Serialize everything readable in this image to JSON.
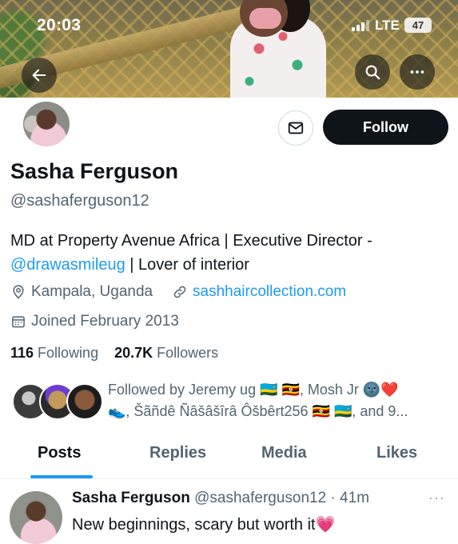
{
  "status_bar": {
    "time": "20:03",
    "network": "LTE",
    "battery": "47"
  },
  "profile": {
    "name": "Sasha Ferguson",
    "handle": "@sashaferguson12",
    "follow_label": "Follow",
    "bio_part1": "MD at Property Avenue Africa | Executive Director -",
    "bio_link": "@drawasmileug",
    "bio_part2": " | Lover of interior",
    "location": "Kampala, Uganda",
    "website": "sashhaircollection.com",
    "joined": "Joined February 2013",
    "following_count": "116",
    "following_label": " Following",
    "followers_count": "20.7K",
    "followers_label": " Followers",
    "followed_by_line1": "Followed by Jeremy ug 🇷🇼 🇺🇬, Mosh Jr 🌚❤️",
    "followed_by_line2": "👟, Šãñdê Ñâšâšîrâ Ôšbêrt256 🇺🇬 🇷🇼, and 9..."
  },
  "tabs": [
    {
      "label": "Posts"
    },
    {
      "label": "Replies"
    },
    {
      "label": "Media"
    },
    {
      "label": "Likes"
    }
  ],
  "post": {
    "author": "Sasha Ferguson",
    "handle_time": " @sashaferguson12 · 41m",
    "text": "New beginnings, scary but worth it💗",
    "more": "···"
  },
  "icons": [
    "back-arrow-icon",
    "search-icon",
    "more-icon",
    "mail-icon",
    "location-pin-icon",
    "link-icon",
    "calendar-icon"
  ],
  "colors": {
    "accent": "#1d9bf0",
    "text": "#0f1419",
    "muted": "#536471",
    "follow_bg": "#0f1419"
  }
}
